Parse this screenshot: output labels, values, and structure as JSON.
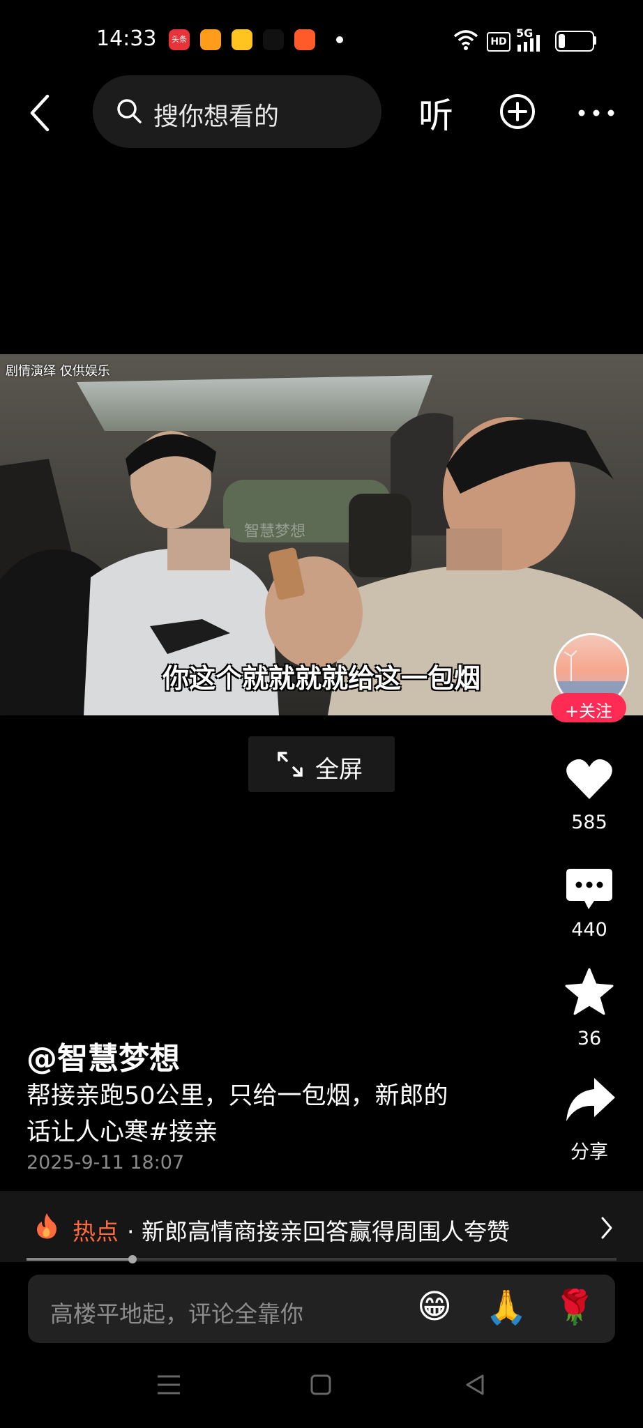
{
  "status_bar": {
    "time": "14:33",
    "app_icons": [
      {
        "name": "toutiao-icon",
        "color": "#e8333a",
        "text": "头条"
      },
      {
        "name": "video-app-icon",
        "color": "#ff9d1a",
        "text": ""
      },
      {
        "name": "diamond-app-icon",
        "color": "#ffc41f",
        "text": ""
      },
      {
        "name": "tiktok-icon",
        "color": "#111111",
        "text": ""
      },
      {
        "name": "play-app-icon",
        "color": "#ff5a2a",
        "text": ""
      }
    ],
    "hd_label": "HD",
    "network_label": "5G",
    "battery_level": 0.2
  },
  "top_nav": {
    "search_placeholder": "搜你想看的",
    "listen_label": "听"
  },
  "video": {
    "overlay_label": "剧情演绎  仅供娱乐",
    "subtitle": "你这个就就就就给这一包烟",
    "watermark": "智慧梦想",
    "fullscreen_label": "全屏"
  },
  "rail": {
    "follow_label": "+关注",
    "likes": "585",
    "comments": "440",
    "favorites": "36",
    "share_label": "分享"
  },
  "post": {
    "author": "@智慧梦想",
    "caption_line1": "帮接亲跑50公里，只给一包烟，新郎的",
    "caption_line2": "话让人心寒#接亲",
    "time": "2025-9-11 18:07"
  },
  "hot": {
    "label": "热点",
    "text": "· 新郎高情商接亲回答赢得周围人夸赞"
  },
  "playback": {
    "progress": 0.18
  },
  "comment": {
    "placeholder": "高楼平地起，评论全靠你",
    "emojis": [
      "😁",
      "🙏",
      "🌹"
    ]
  },
  "colors": {
    "accent": "#fe2c55",
    "hot": "#ff6b3d"
  }
}
